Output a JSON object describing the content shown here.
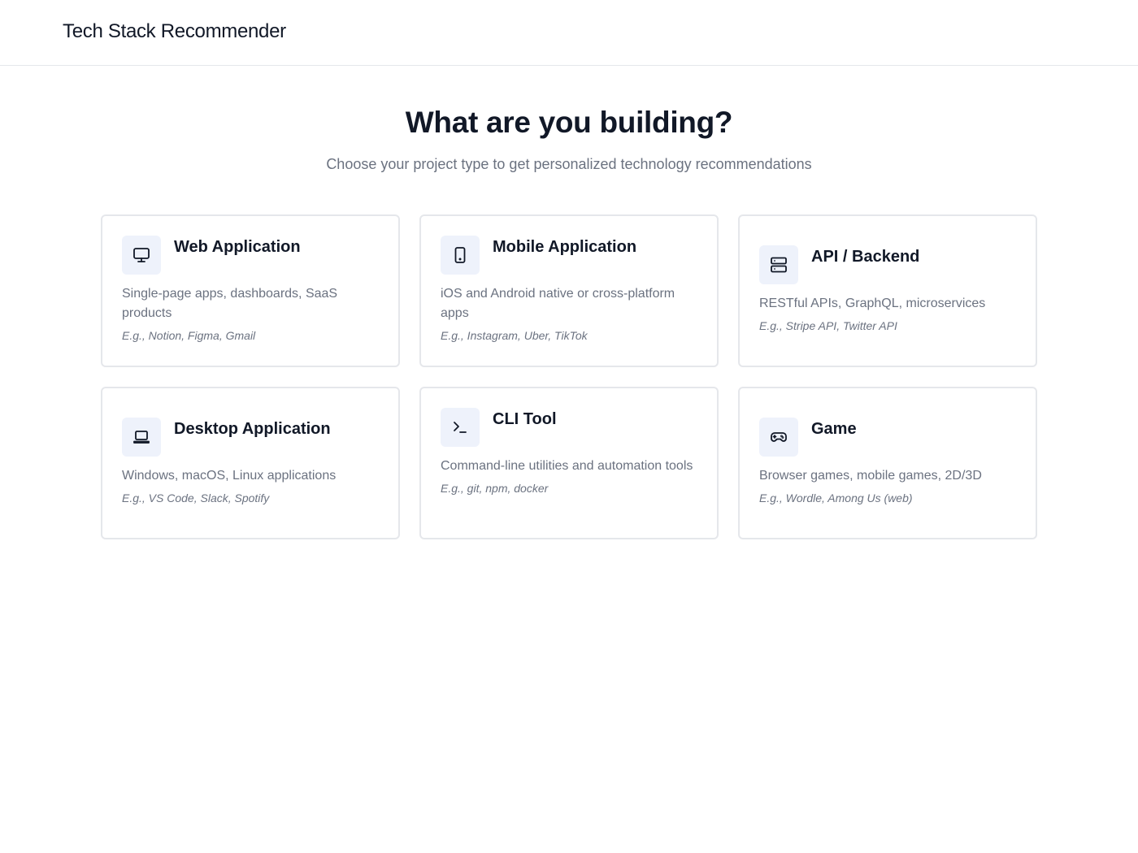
{
  "header": {
    "app_title": "Tech Stack Recommender"
  },
  "hero": {
    "title": "What are you building?",
    "subtitle": "Choose your project type to get personalized technology recommendations"
  },
  "project_types": [
    {
      "icon": "monitor-icon",
      "title": "Web Application",
      "description": "Single-page apps, dashboards, SaaS products",
      "examples": "E.g., Notion, Figma, Gmail"
    },
    {
      "icon": "smartphone-icon",
      "title": "Mobile Application",
      "description": "iOS and Android native or cross-platform apps",
      "examples": "E.g., Instagram, Uber, TikTok"
    },
    {
      "icon": "server-icon",
      "title": "API / Backend",
      "description": "RESTful APIs, GraphQL, microservices",
      "examples": "E.g., Stripe API, Twitter API"
    },
    {
      "icon": "laptop-icon",
      "title": "Desktop Application",
      "description": "Windows, macOS, Linux applications",
      "examples": "E.g., VS Code, Slack, Spotify"
    },
    {
      "icon": "terminal-icon",
      "title": "CLI Tool",
      "description": "Command-line utilities and automation tools",
      "examples": "E.g., git, npm, docker"
    },
    {
      "icon": "gamepad-icon",
      "title": "Game",
      "description": "Browser games, mobile games, 2D/3D",
      "examples": "E.g., Wordle, Among Us (web)"
    }
  ],
  "colors": {
    "icon_background": "#eef2fb",
    "card_border": "#e5e7eb",
    "muted_text": "#6b7280",
    "heading_text": "#111827"
  }
}
